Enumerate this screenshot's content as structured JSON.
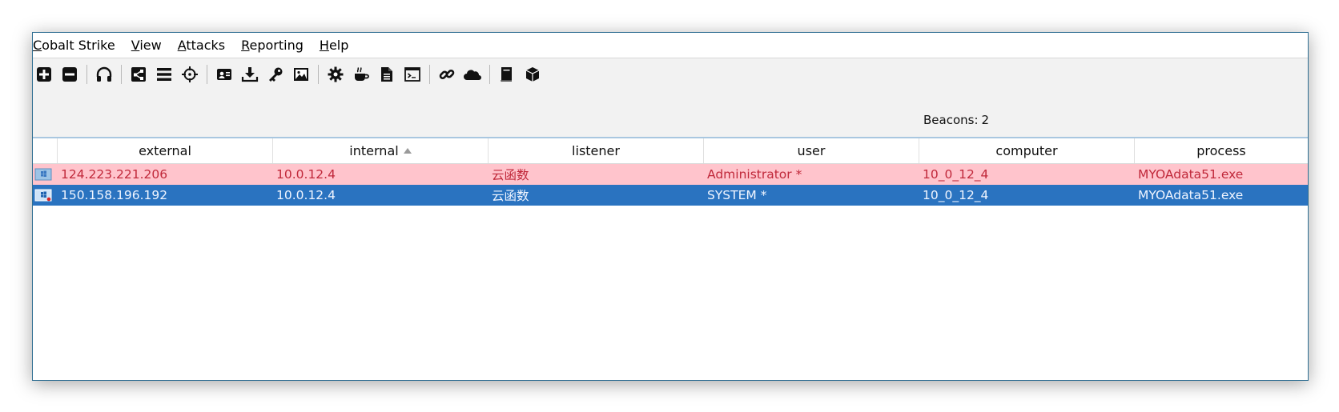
{
  "menu": [
    {
      "mnemonic": "C",
      "rest": "obalt Strike"
    },
    {
      "mnemonic": "V",
      "rest": "iew"
    },
    {
      "mnemonic": "A",
      "rest": "ttacks"
    },
    {
      "mnemonic": "R",
      "rest": "eporting"
    },
    {
      "mnemonic": "H",
      "rest": "elp"
    }
  ],
  "toolbar": {
    "icons": [
      "new-connection-icon",
      "disconnect-icon",
      "listeners-icon",
      "pivot-graph-icon",
      "session-table-icon",
      "targets-icon",
      "credentials-icon",
      "downloads-icon",
      "keystrokes-icon",
      "screenshots-icon",
      "generate-payload-icon",
      "java-attack-icon",
      "ms-office-macro-icon",
      "web-delivery-icon",
      "web-drive-by-icon",
      "host-file-icon",
      "help-book-icon",
      "about-cube-icon"
    ]
  },
  "status": {
    "beacons_label": "Beacons:",
    "beacons_count": "2"
  },
  "table": {
    "columns": [
      "external",
      "internal",
      "listener",
      "user",
      "computer",
      "process"
    ],
    "sorted_column": "internal",
    "sort_direction": "ascending",
    "rows": [
      {
        "external": "124.223.221.206",
        "internal": "10.0.12.4",
        "listener": "云函数",
        "user": "Administrator *",
        "computer": "10_0_12_4",
        "process": "MYOAdata51.exe",
        "state": "pink",
        "os_icon": "windows-host-icon"
      },
      {
        "external": "150.158.196.192",
        "internal": "10.0.12.4",
        "listener": "云函数",
        "user": "SYSTEM *",
        "computer": "10_0_12_4",
        "process": "MYOAdata51.exe",
        "state": "selected",
        "os_icon": "windows-host-icon"
      }
    ]
  },
  "colors": {
    "pink_row": "#ffc4cc",
    "pink_text": "#c0283a",
    "selected_row": "#2a73c0",
    "selected_text": "#f0f5ff",
    "window_border": "#2f6e92"
  }
}
